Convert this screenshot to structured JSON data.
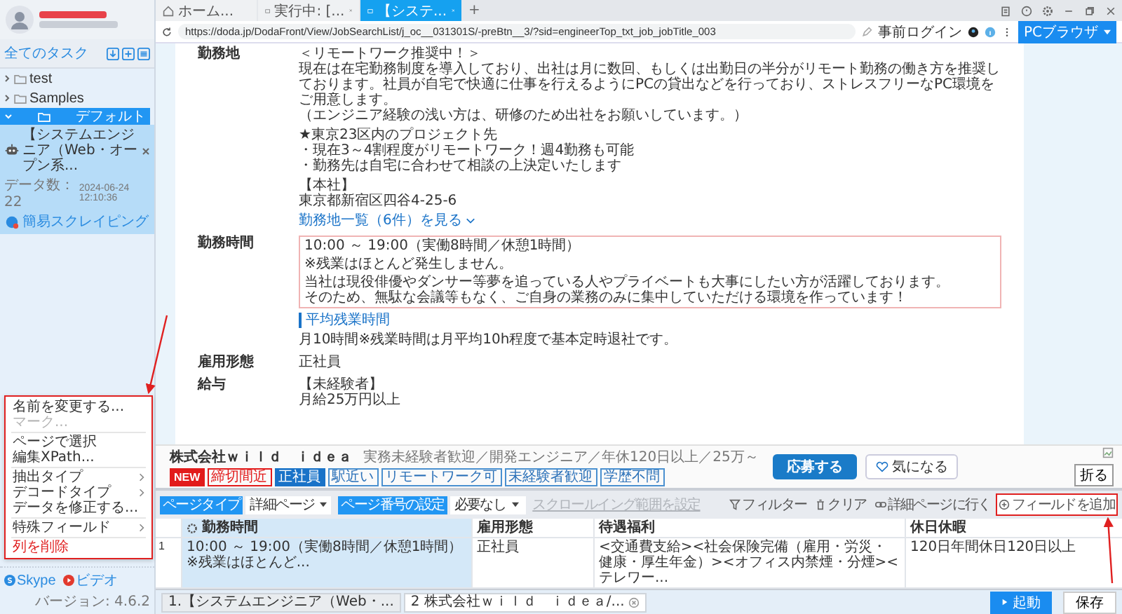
{
  "sidebar": {
    "title": "全てのタスク",
    "folders": [
      {
        "label": "test",
        "expanded": false,
        "selected": false
      },
      {
        "label": "Samples",
        "expanded": false,
        "selected": false
      },
      {
        "label": "デフォルト",
        "expanded": true,
        "selected": true,
        "tasks": [
          {
            "title": "【システムエンジニア（Web・オープン系...",
            "count_label": "データ数：",
            "count": "22",
            "time": "2024-06-24 12:10:36",
            "mode": "簡易スクレイピング"
          }
        ]
      }
    ],
    "links": [
      {
        "kind": "skype",
        "label": "Skype"
      },
      {
        "kind": "video",
        "label": "ビデオ"
      }
    ],
    "version": "バージョン: 4.6.2"
  },
  "browser_tabs": [
    {
      "kind": "home",
      "label": "ホーム...",
      "selected": false,
      "closable": false
    },
    {
      "kind": "page",
      "label": "実行中: [...",
      "selected": false,
      "closable": true
    },
    {
      "kind": "page",
      "label": "【システ...",
      "selected": true,
      "closable": true
    }
  ],
  "new_tab": "+",
  "address_bar": {
    "url": "https://doda.jp/DodaFront/View/JobSearchList/j_oc__031301S/-preBtn__3/?sid=engineerTop_txt_job_jobTitle_003",
    "login": "事前ログイン",
    "mode_button": "PCブラウザ"
  },
  "job_details": [
    {
      "label": "勤務地",
      "kind": "plain",
      "paragraphs": [
        [
          "＜リモートワーク推奨中！＞",
          "現在は在宅勤務制度を導入しており、出社は月に数回、もしくは出勤日の半分がリモート勤務の働き方を推奨しております。社員が自宅で快適に仕事を行えるようにPCの貸出などを行っており、ストレスフリーなPC環境をご用意します。",
          "（エンジニア経験の浅い方は、研修のため出社をお願いしています。）"
        ],
        [
          "★東京23区内のプロジェクト先",
          "・現在3～4割程度がリモートワーク！週4勤務も可能",
          "・勤務先は自宅に合わせて相談の上決定いたします"
        ],
        [
          "【本社】",
          "東京都新宿区四谷4-25-6"
        ]
      ],
      "link": "勤務地一覧（6件）を見る"
    },
    {
      "label": "勤務時間",
      "kind": "boxed",
      "paragraphs": [
        [
          "10:00 ～ 19:00（実働8時間／休憩1時間）"
        ],
        [
          "※残業はほとんど発生しません。"
        ],
        [
          "当社は現役俳優やダンサー等夢を追っている人やプライベートも大事にしたい方が活躍しております。",
          "そのため、無駄な会議等もなく、ご自身の業務のみに集中していただける環境を作っています！"
        ]
      ],
      "note_heading": "平均残業時間",
      "note": "月10時間※残業時間は月平均10h程度で基本定時退社です。"
    },
    {
      "label": "雇用形態",
      "kind": "plain",
      "paragraphs": [
        [
          "正社員"
        ]
      ]
    },
    {
      "label": "給与",
      "kind": "plain",
      "paragraphs": [
        [
          "【未経験者】",
          "月給25万円以上"
        ]
      ]
    }
  ],
  "apply_bar": {
    "company": "株式会社ｗｉｌｄ　ｉｄｅａ",
    "summary": "実務未経験者歓迎／開発エンジニア／年休120日以上／25万～",
    "tags": [
      {
        "label": "NEW",
        "kind": "new"
      },
      {
        "label": "締切間近",
        "kind": "alert"
      },
      {
        "label": "正社員",
        "kind": "primary"
      },
      {
        "label": "駅近い",
        "kind": "outline"
      },
      {
        "label": "リモートワーク可",
        "kind": "outline"
      },
      {
        "label": "未経験者歓迎",
        "kind": "outline"
      },
      {
        "label": "学歴不問",
        "kind": "outline"
      }
    ],
    "apply": "応募する",
    "favorite": "気になる",
    "collapse": "折る"
  },
  "toolbar": {
    "page_type_label": "ページタイプ",
    "page_type": "詳細ページ",
    "page_number_label": "ページ番号の設定",
    "page_number": "必要なし",
    "scroll_range": {
      "label": "スクロールイング範囲を設定",
      "disabled": true
    },
    "actions": [
      {
        "kind": "filter",
        "label": "フィルター",
        "highlighted": false
      },
      {
        "kind": "clear",
        "label": "クリア",
        "highlighted": false
      },
      {
        "kind": "detail",
        "label": "詳細ページに行く",
        "highlighted": false
      },
      {
        "kind": "add",
        "label": "フィールドを追加",
        "highlighted": true
      }
    ]
  },
  "table": {
    "columns": [
      {
        "label": "勤務時間",
        "selected": true
      },
      {
        "label": "雇用形態",
        "selected": false
      },
      {
        "label": "待遇福利",
        "selected": false
      },
      {
        "label": "休日休暇",
        "selected": false
      }
    ],
    "rows": [
      {
        "index": "1",
        "cells": [
          "10:00 ～ 19:00（実働8時間／休憩1時間）※残業はほとんど...",
          "正社員",
          "<交通費支給><社会保険完備（雇用・労災・健康・厚生年金）><オフィス内禁煙・分煙><テレワー...",
          "120日年間休日120日以上"
        ]
      }
    ]
  },
  "context_menu": [
    {
      "label": "名前を変更する...",
      "kind": "item",
      "disabled": false,
      "divider_after": false
    },
    {
      "label": "マーク...",
      "kind": "item",
      "disabled": true,
      "divider_after": true
    },
    {
      "label": "ページで選択",
      "kind": "item",
      "disabled": false,
      "divider_after": false
    },
    {
      "label": "編集XPath...",
      "kind": "item",
      "disabled": false,
      "divider_after": true
    },
    {
      "label": "抽出タイプ",
      "kind": "submenu",
      "disabled": false,
      "divider_after": false
    },
    {
      "label": "デコードタイプ",
      "kind": "submenu",
      "disabled": false,
      "divider_after": false
    },
    {
      "label": "データを修正する...",
      "kind": "item",
      "disabled": false,
      "divider_after": true
    },
    {
      "label": "特殊フィールド",
      "kind": "submenu",
      "disabled": false,
      "divider_after": true
    },
    {
      "label": "列を削除",
      "kind": "danger",
      "disabled": false,
      "divider_after": false
    }
  ],
  "task_tabs": [
    {
      "label": "1.【システムエンジニア（Web・...",
      "selected": false,
      "closable": false
    },
    {
      "label": "2 株式会社ｗｉｌｄ　ｉｄｅａ/...",
      "selected": true,
      "closable": true
    }
  ],
  "actions": {
    "run": "起動",
    "save": "保存"
  }
}
